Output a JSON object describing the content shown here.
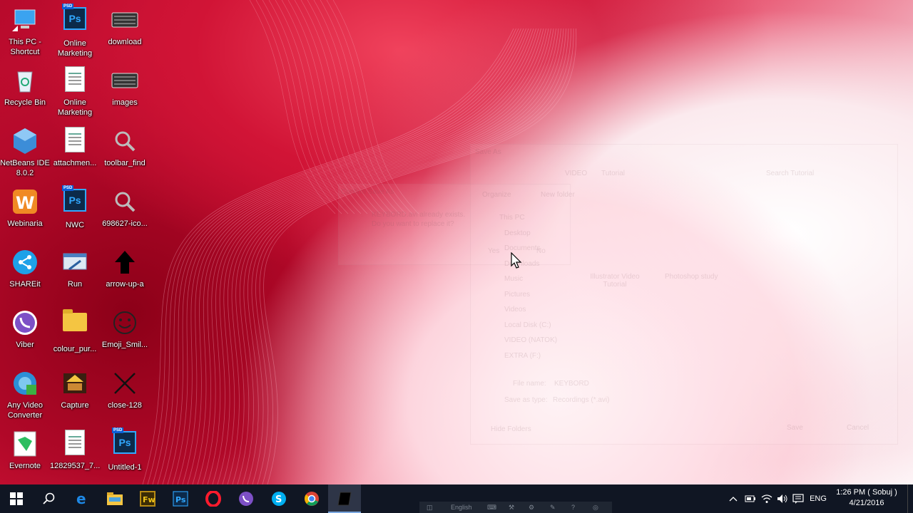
{
  "desktop_icons": [
    {
      "label": "This PC -\nShortcut",
      "icon": "this-pc-icon"
    },
    {
      "label": "Online\nMarketing",
      "icon": "photoshop-file-icon",
      "badge": "PSD",
      "glyph": "Ps"
    },
    {
      "label": "download",
      "icon": "keyboard-image-icon"
    },
    {
      "label": "Recycle Bin",
      "icon": "recycle-bin-icon"
    },
    {
      "label": "Online\nMarketing",
      "icon": "document-icon"
    },
    {
      "label": "images",
      "icon": "keyboard-image-icon"
    },
    {
      "label": "NetBeans IDE\n8.0.2",
      "icon": "netbeans-icon"
    },
    {
      "label": "attachmen...",
      "icon": "document-icon"
    },
    {
      "label": "toolbar_find",
      "icon": "search-image-icon"
    },
    {
      "label": "Webinaria",
      "icon": "webinaria-icon"
    },
    {
      "label": "NWC",
      "icon": "photoshop-file-icon",
      "badge": "PSD",
      "glyph": "Ps"
    },
    {
      "label": "698627-ico...",
      "icon": "search-image-icon"
    },
    {
      "label": "SHAREit",
      "icon": "shareit-icon"
    },
    {
      "label": "Run",
      "icon": "run-icon"
    },
    {
      "label": "arrow-up-a",
      "icon": "arrow-up-icon"
    },
    {
      "label": "Viber",
      "icon": "viber-icon"
    },
    {
      "label": "colour_pur...",
      "icon": "folder-icon"
    },
    {
      "label": "Emoji_Smil...",
      "icon": "emoji-smile-icon"
    },
    {
      "label": "Any Video\nConverter",
      "icon": "video-converter-icon"
    },
    {
      "label": "Capture",
      "icon": "capture-icon"
    },
    {
      "label": "close-128",
      "icon": "close-x-icon"
    },
    {
      "label": "Evernote",
      "icon": "evernote-icon"
    },
    {
      "label": "12829537_7...",
      "icon": "document-icon"
    },
    {
      "label": "Untitled-1",
      "icon": "photoshop-file-icon",
      "badge": "PSD",
      "glyph": "Ps"
    }
  ],
  "ghost_dialogs": {
    "confirm": {
      "title": "Confirm Save As",
      "message_line1": "KEYBORD.avi already exists.",
      "message_line2": "Do you want to replace it?",
      "yes_label": "Yes",
      "no_label": "No"
    },
    "save_as": {
      "title": "Save As",
      "path_parts": [
        "VIDEO",
        "Tutorial"
      ],
      "search_placeholder": "Search Tutorial",
      "organize_label": "Organize",
      "new_folder_label": "New folder",
      "nav_items": [
        "This PC",
        "Desktop",
        "Documents",
        "Downloads",
        "Music",
        "Pictures",
        "Videos",
        "Local Disk (C:)",
        "VIDEO (NATOK)",
        "EXTRA (F:)"
      ],
      "files": [
        "Illustrator Video\nTutorial",
        "Photoshop study"
      ],
      "file_name_label": "File name:",
      "file_name_value": "KEYBORD",
      "save_type_label": "Save as type:",
      "save_type_value": "Recordings (*.avi)",
      "hide_folders_label": "Hide Folders",
      "save_label": "Save",
      "cancel_label": "Cancel"
    }
  },
  "taskbar": {
    "apps": [
      "start-icon",
      "search-icon",
      "edge-icon",
      "file-explorer-icon",
      "fireworks-icon",
      "photoshop-icon",
      "opera-icon",
      "viber-icon",
      "skype-icon",
      "chrome-icon",
      "recorder-app-icon"
    ],
    "tray_language": "ENG",
    "clock_time": "1:26 PM ( Sobuj )",
    "clock_date": "4/21/2016",
    "language_bar_text": "English"
  }
}
